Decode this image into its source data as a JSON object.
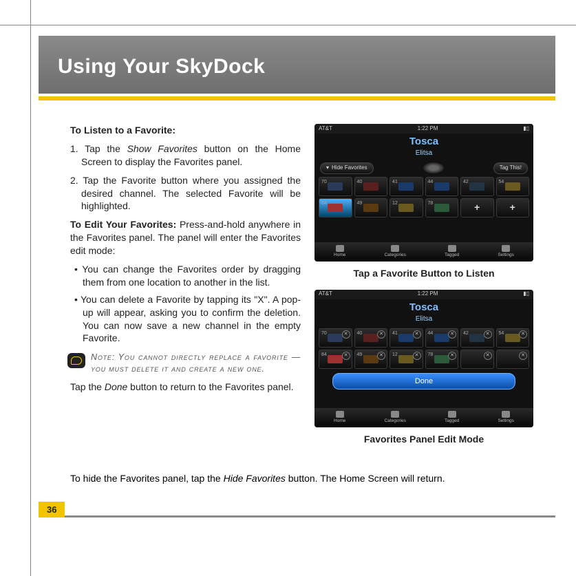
{
  "header": {
    "title": "Using Your SkyDock"
  },
  "pageNumber": "36",
  "text": {
    "listenHeading": "To Listen to a Favorite:",
    "step1_pre": "1. Tap the ",
    "step1_em": "Show Favorites",
    "step1_post": " button on the Home Screen to display the Favorites panel.",
    "step2": "2. Tap the Favorite button where you assigned the desired channel. The selected Favorite will be highlighted.",
    "editHeading": "To Edit Your Favorites:",
    "editBody": " Press-and-hold anywhere in the Favorites panel. The panel will enter the Favorites edit mode:",
    "bullet1": "• You can change the Favorites order by dragging them from one location to another in the list.",
    "bullet2": "• You can delete a Favorite by tapping its \"X\". A pop-up will appear, asking you to confirm the deletion. You can now save a new channel in the empty Favorite.",
    "note": "Note: You cannot directly replace a favorite — you must delete it and create a new one.",
    "done_pre": "Tap the ",
    "done_em": "Done",
    "done_post": " button to return to the Favorites panel.",
    "hide_pre": "To hide the Favorites panel, tap the ",
    "hide_em": "Hide Favorites",
    "hide_post": " button. The Home Screen will return."
  },
  "captions": {
    "shot1": "Tap a Favorite Button to Listen",
    "shot2": "Favorites Panel Edit Mode"
  },
  "phone": {
    "carrier": "AT&T",
    "time": "1:22 PM",
    "title": "Tosca",
    "subtitle": "Elitsa",
    "hideFav": "Hide Favorites",
    "tagThis": "Tag This!",
    "done": "Done",
    "tabs": [
      "Home",
      "Categories",
      "Tagged",
      "Settings"
    ],
    "cells": [
      "70",
      "40",
      "41",
      "44",
      "42",
      "54",
      "84",
      "49",
      "12",
      "78"
    ]
  }
}
